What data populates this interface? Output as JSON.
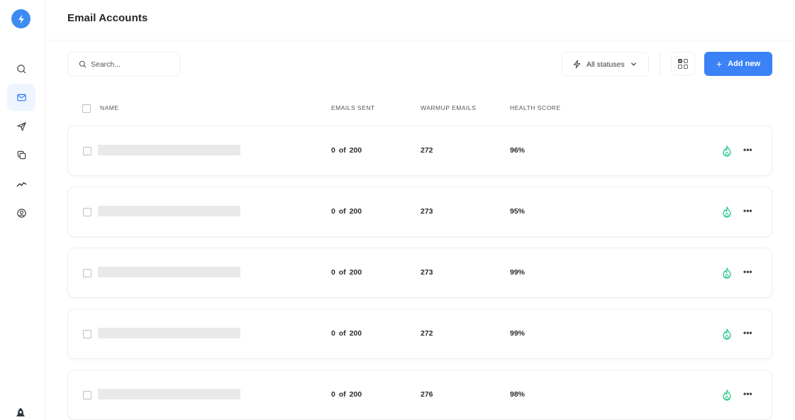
{
  "header": {
    "title": "Email Accounts"
  },
  "sidebar": {
    "logo_icon": "lightning-bolt-icon",
    "items": [
      {
        "name": "search",
        "icon": "search-icon",
        "active": false
      },
      {
        "name": "email-accounts",
        "icon": "mail-icon",
        "active": true
      },
      {
        "name": "campaigns",
        "icon": "send-icon",
        "active": false
      },
      {
        "name": "templates",
        "icon": "copy-icon",
        "active": false
      },
      {
        "name": "analytics",
        "icon": "chart-line-icon",
        "active": false
      },
      {
        "name": "profile",
        "icon": "user-circle-icon",
        "active": false
      }
    ],
    "bottom_icon": "rocket-icon"
  },
  "toolbar": {
    "search_placeholder": "Search...",
    "status_filter_label": "All statuses",
    "add_button_label": "Add new",
    "add_button_icon": "plus"
  },
  "colors": {
    "accent": "#3b82f6",
    "logo": "#3d8bf2",
    "active_nav_bg": "#eef5fe",
    "warmup_icon": "#34c98e"
  },
  "table": {
    "columns": [
      "NAME",
      "EMAILS SENT",
      "WARMUP EMAILS",
      "HEALTH SCORE"
    ],
    "rows": [
      {
        "name": "",
        "emails_sent": "0 of 200",
        "warmup_emails": "272",
        "health_score": "96%"
      },
      {
        "name": "",
        "emails_sent": "0 of 200",
        "warmup_emails": "273",
        "health_score": "95%"
      },
      {
        "name": "",
        "emails_sent": "0 of 200",
        "warmup_emails": "273",
        "health_score": "99%"
      },
      {
        "name": "",
        "emails_sent": "0 of 200",
        "warmup_emails": "272",
        "health_score": "99%"
      },
      {
        "name": "",
        "emails_sent": "0 of 200",
        "warmup_emails": "276",
        "health_score": "98%"
      }
    ],
    "row_more_label": "•••"
  }
}
